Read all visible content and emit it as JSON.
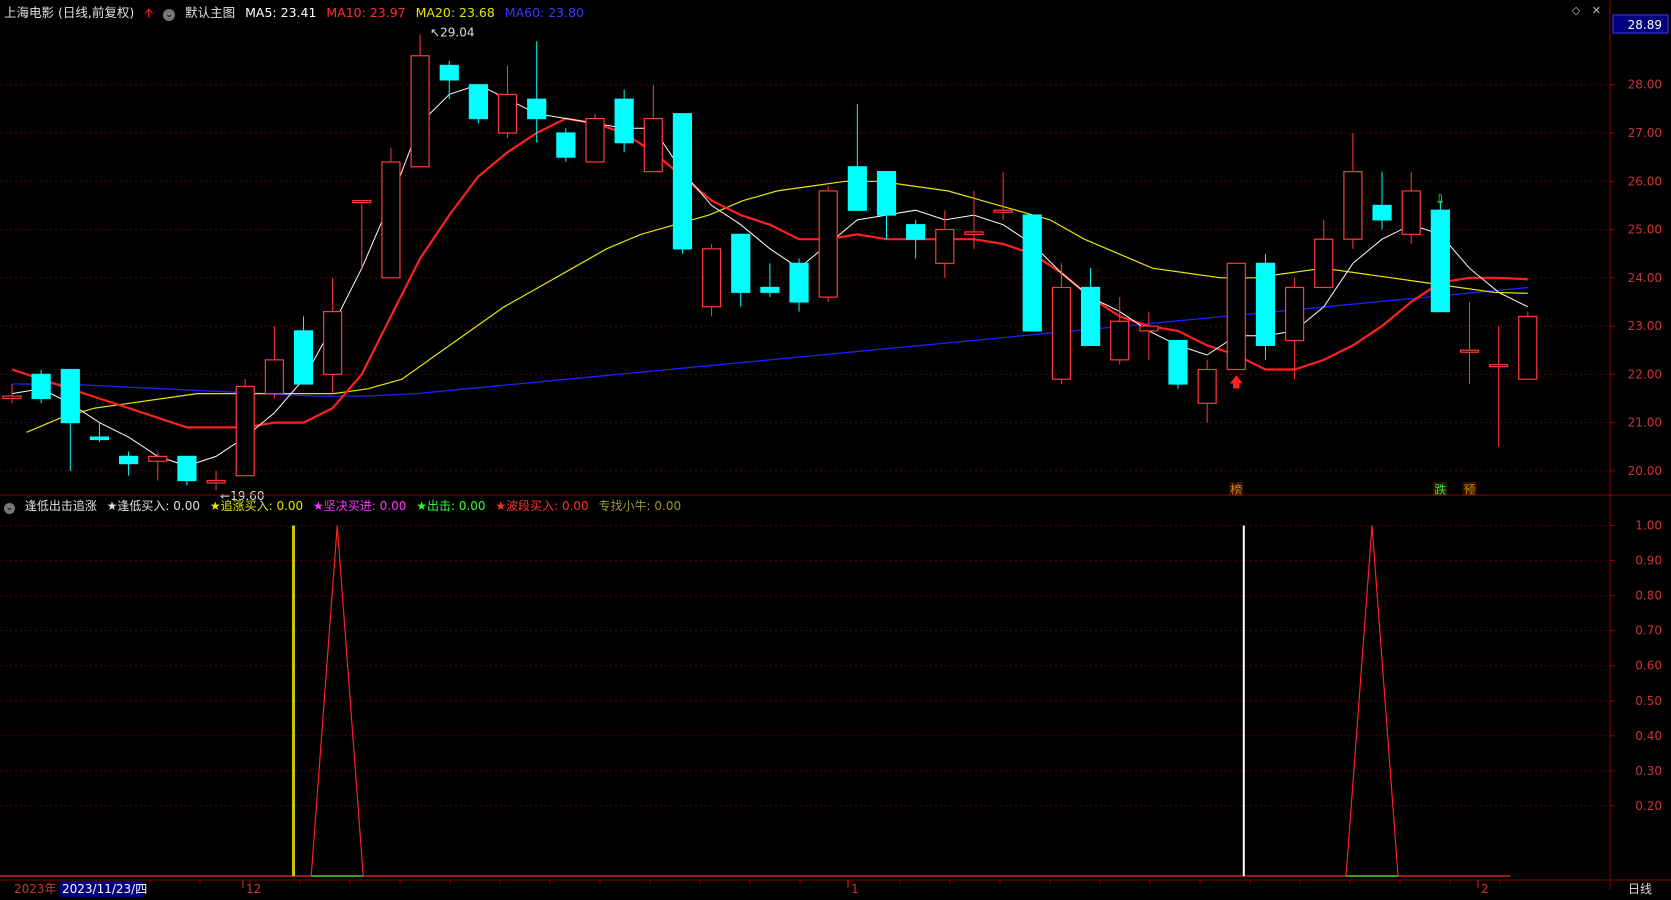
{
  "header": {
    "stock_title": "上海电影 (日线,前复权)",
    "template_label": "默认主图",
    "ma5": "MA5: 23.41",
    "ma10": "MA10: 23.97",
    "ma20": "MA20: 23.68",
    "ma60": "MA60: 23.80",
    "icons": [
      "arrow-up-icon",
      "chevron-down-icon",
      "diamond-icon",
      "close-icon"
    ]
  },
  "indicator_header": {
    "name": "逢低出击追涨",
    "di": "★逢低买入: 0.00",
    "zz": "★追涨买入: 0.00",
    "jj": "★坚决买进: 0.00",
    "cj": "★出击: 0.00",
    "bd": "★波段买入: 0.00",
    "zx": "专找小牛: 0.00"
  },
  "price_axis": {
    "current_price": "28.89",
    "ticks": [
      "28.00",
      "27.00",
      "26.00",
      "25.00",
      "24.00",
      "23.00",
      "22.00",
      "21.00",
      "20.00"
    ]
  },
  "indicator_axis": {
    "ticks": [
      "1.00",
      "0.90",
      "0.80",
      "0.70",
      "0.60",
      "0.50",
      "0.40",
      "0.30",
      "0.20"
    ]
  },
  "date_axis": {
    "year_label": "2023年",
    "cursor_date": "2023/11/23/四",
    "month_marks": [
      "12",
      "1",
      "2"
    ],
    "period_label": "日线"
  },
  "annotations": {
    "high": "29.04",
    "low": "19.60",
    "signals": [
      "榜",
      "跌",
      "预"
    ]
  },
  "colors": {
    "up": "#ff3b3b",
    "down": "#00ffff",
    "ma5": "#ffffff",
    "ma10": "#ff2020",
    "ma20": "#e6e600",
    "ma60": "#2020ff",
    "grid": "#5a0000",
    "axis_text": "#cc3333"
  },
  "chart_data": {
    "type": "candlestick",
    "candles": [
      [
        21.5,
        21.55,
        21.8,
        21.4
      ],
      [
        22.0,
        21.5,
        22.1,
        21.4
      ],
      [
        22.1,
        21.0,
        22.1,
        20.0
      ],
      [
        20.7,
        20.65,
        21.0,
        20.6
      ],
      [
        20.3,
        20.15,
        20.4,
        19.9
      ],
      [
        20.2,
        20.3,
        20.4,
        19.8
      ],
      [
        20.3,
        19.8,
        20.3,
        19.7
      ],
      [
        19.75,
        19.8,
        20.0,
        19.6
      ],
      [
        19.9,
        21.75,
        21.9,
        19.9
      ],
      [
        21.6,
        22.3,
        23.0,
        21.5
      ],
      [
        22.9,
        21.8,
        23.2,
        21.8
      ],
      [
        22.0,
        23.3,
        24.0,
        21.6
      ],
      [
        25.6,
        25.6,
        25.6,
        24.2
      ],
      [
        24.0,
        26.4,
        26.7,
        24.1
      ],
      [
        26.3,
        28.6,
        29.04,
        26.3
      ],
      [
        28.4,
        28.1,
        28.5,
        27.7
      ],
      [
        28.0,
        27.3,
        28.0,
        27.2
      ],
      [
        27.0,
        27.8,
        28.4,
        26.9
      ],
      [
        27.7,
        27.3,
        28.9,
        26.8
      ],
      [
        27.0,
        26.5,
        27.1,
        26.4
      ],
      [
        26.4,
        27.3,
        27.4,
        26.4
      ],
      [
        27.7,
        26.8,
        27.9,
        26.6
      ],
      [
        26.2,
        27.3,
        28.0,
        26.2
      ],
      [
        27.4,
        24.6,
        27.4,
        24.5
      ],
      [
        23.4,
        24.6,
        24.7,
        23.2
      ],
      [
        24.9,
        23.7,
        24.9,
        23.4
      ],
      [
        23.8,
        23.7,
        24.3,
        23.6
      ],
      [
        24.3,
        23.5,
        24.4,
        23.3
      ],
      [
        23.6,
        25.8,
        25.9,
        23.5
      ],
      [
        26.3,
        25.4,
        27.6,
        25.6
      ],
      [
        26.2,
        25.3,
        26.2,
        24.8
      ],
      [
        25.1,
        24.8,
        25.2,
        24.4
      ],
      [
        24.3,
        25.0,
        25.4,
        24.0
      ],
      [
        24.9,
        24.95,
        25.8,
        24.6
      ],
      [
        25.4,
        25.4,
        26.2,
        25.2
      ],
      [
        25.3,
        22.9,
        25.3,
        22.9
      ],
      [
        21.9,
        23.8,
        24.3,
        21.8
      ],
      [
        23.8,
        22.6,
        24.2,
        22.6
      ],
      [
        22.3,
        23.1,
        23.6,
        22.2
      ],
      [
        22.9,
        23.0,
        23.3,
        22.3
      ],
      [
        22.7,
        21.8,
        22.7,
        21.7
      ],
      [
        21.4,
        22.1,
        22.3,
        21.0
      ],
      [
        22.1,
        24.3,
        24.3,
        22.1
      ],
      [
        24.3,
        22.6,
        24.5,
        22.3
      ],
      [
        22.7,
        23.8,
        24.0,
        21.9
      ],
      [
        23.8,
        24.8,
        25.2,
        23.9
      ],
      [
        24.8,
        26.2,
        27.0,
        24.6
      ],
      [
        25.5,
        25.2,
        26.2,
        25.0
      ],
      [
        24.9,
        25.8,
        26.2,
        24.7
      ],
      [
        25.4,
        23.3,
        25.6,
        23.3
      ],
      [
        22.5,
        22.5,
        23.5,
        21.8
      ],
      [
        22.2,
        22.2,
        23.0,
        20.5
      ],
      [
        21.9,
        23.2,
        23.3,
        21.9
      ]
    ],
    "ma5": [
      21.6,
      21.7,
      21.4,
      21.0,
      20.7,
      20.3,
      20.1,
      20.3,
      20.7,
      21.2,
      21.9,
      23.0,
      24.2,
      25.6,
      27.2,
      27.8,
      28.0,
      27.7,
      27.4,
      27.3,
      27.2,
      27.1,
      27.1,
      26.2,
      25.5,
      25.1,
      24.6,
      24.2,
      24.7,
      25.2,
      25.3,
      25.4,
      25.2,
      25.3,
      25.1,
      24.7,
      24.1,
      23.6,
      23.3,
      22.9,
      22.6,
      22.4,
      22.8,
      22.8,
      22.9,
      23.4,
      24.3,
      24.8,
      25.1,
      24.9,
      24.2,
      23.7,
      23.4
    ],
    "ma10": [
      22.1,
      21.9,
      21.7,
      21.5,
      21.3,
      21.1,
      20.9,
      20.9,
      20.9,
      21.0,
      21.0,
      21.3,
      22.0,
      23.2,
      24.4,
      25.3,
      26.1,
      26.6,
      27.0,
      27.3,
      27.2,
      27.0,
      26.6,
      26.1,
      25.6,
      25.3,
      25.1,
      24.8,
      24.8,
      24.9,
      24.8,
      24.8,
      24.8,
      24.8,
      24.7,
      24.5,
      24.1,
      23.6,
      23.2,
      23.0,
      22.9,
      22.6,
      22.4,
      22.1,
      22.1,
      22.3,
      22.6,
      23.0,
      23.5,
      23.9,
      24.0,
      24.0,
      23.97
    ],
    "ma20": [
      20.8,
      21.1,
      21.3,
      21.4,
      21.5,
      21.6,
      21.6,
      21.6,
      21.6,
      21.6,
      21.7,
      21.9,
      22.4,
      22.9,
      23.4,
      23.8,
      24.2,
      24.6,
      24.9,
      25.1,
      25.3,
      25.6,
      25.8,
      25.9,
      26.0,
      26.0,
      25.9,
      25.8,
      25.6,
      25.4,
      25.2,
      24.8,
      24.5,
      24.2,
      24.1,
      24.0,
      24.0,
      24.1,
      24.2,
      24.1,
      24.0,
      23.9,
      23.8,
      23.7,
      23.68
    ],
    "ma60": [
      21.8,
      21.8,
      21.75,
      21.7,
      21.65,
      21.6,
      21.55,
      21.55,
      21.6,
      21.7,
      21.8,
      21.9,
      22.0,
      22.1,
      22.2,
      22.3,
      22.4,
      22.5,
      22.6,
      22.7,
      22.8,
      22.9,
      23.0,
      23.1,
      23.2,
      23.3,
      23.4,
      23.5,
      23.6,
      23.7,
      23.8
    ],
    "ylim": [
      19.5,
      29.3
    ],
    "indicator": {
      "ylim": [
        0,
        1.03
      ],
      "spikes": [
        {
          "index": 10,
          "value": 1,
          "color": "#c8c800"
        },
        {
          "index": 11.5,
          "value": 1,
          "color": "#ff2020"
        },
        {
          "index": 42.6,
          "value": 1,
          "color": "#ffffff"
        },
        {
          "index": 47,
          "value": 1,
          "color": "#ff2020"
        }
      ]
    }
  }
}
